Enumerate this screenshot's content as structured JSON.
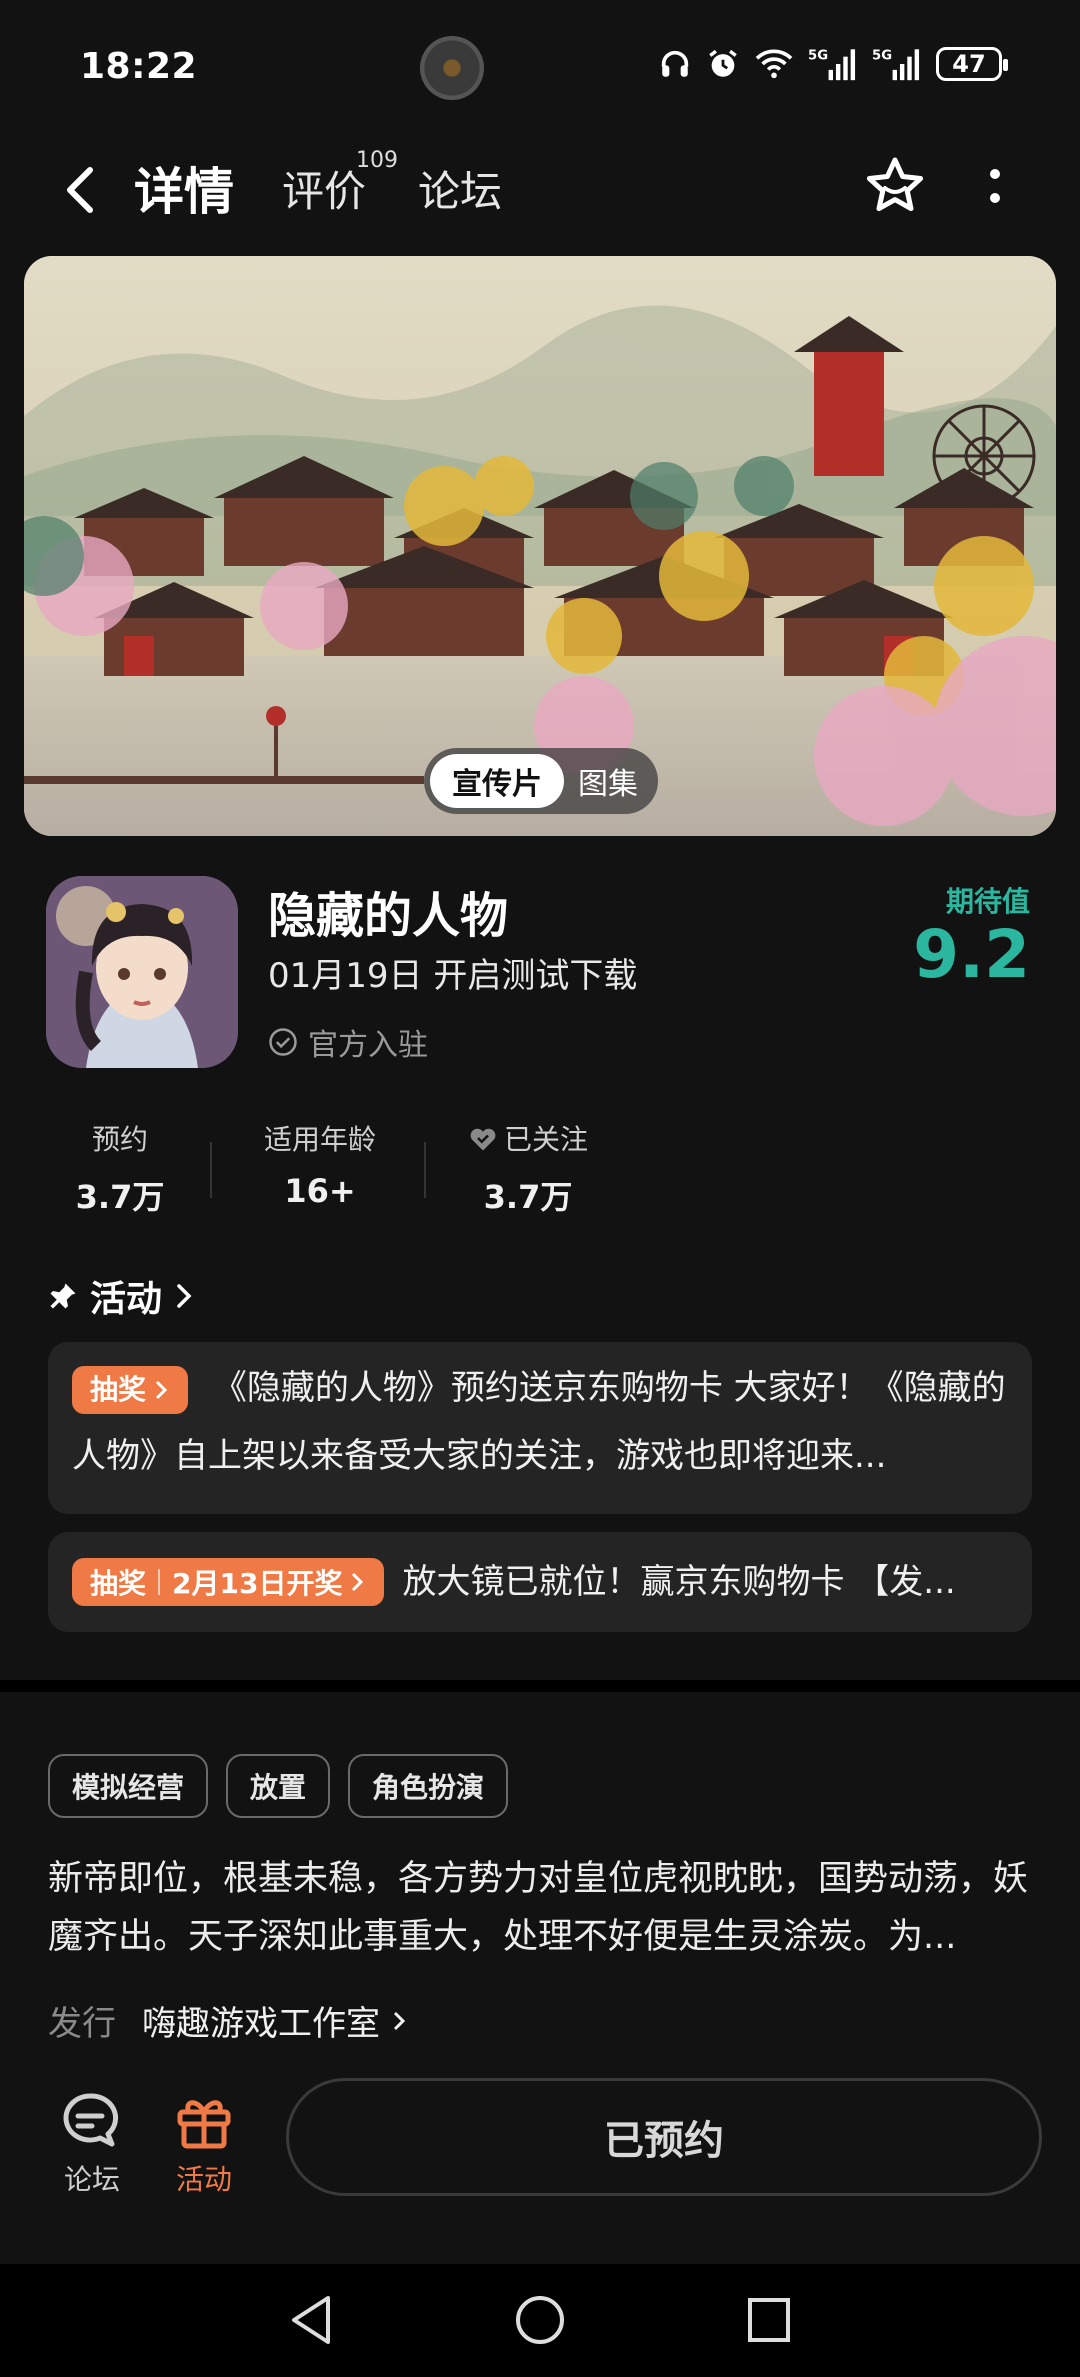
{
  "status_bar": {
    "time": "18:22",
    "battery": "47"
  },
  "nav": {
    "tabs": [
      {
        "label": "详情",
        "active": true
      },
      {
        "label": "评价",
        "count": "109"
      },
      {
        "label": "论坛"
      }
    ]
  },
  "hero": {
    "switch": {
      "active": "宣传片",
      "inactive": "图集"
    }
  },
  "app": {
    "name": "隐藏的人物",
    "subtitle": "01月19日 开启测试下载",
    "official": "官方入驻",
    "expect_label": "期待值",
    "expect_value": "9.2"
  },
  "stats": [
    {
      "label": "预约",
      "value": "3.7万"
    },
    {
      "label": "适用年龄",
      "value": "16+"
    },
    {
      "label": "已关注",
      "value": "3.7万"
    }
  ],
  "activity": {
    "heading": "活动",
    "items": [
      {
        "badge": "抽奖",
        "text": "《隐藏的人物》预约送京东购物卡 大家好！《隐藏的人物》自上架以来备受大家的关注，游戏也即将迎来..."
      },
      {
        "badge": "抽奖",
        "badge_extra": "2月13日开奖",
        "text": "放大镜已就位！赢京东购物卡 【发..."
      }
    ]
  },
  "tags": [
    "模拟经营",
    "放置",
    "角色扮演"
  ],
  "description": "新帝即位，根基未稳，各方势力对皇位虎视眈眈，国势动荡，妖魔齐出。天子深知此事重大，处理不好便是生灵涂炭。为...",
  "publisher": {
    "label": "发行",
    "name": "嗨趣游戏工作室"
  },
  "bottom_bar": {
    "forum_label": "论坛",
    "activity_label": "活动",
    "action_label": "已预约"
  },
  "colors": {
    "accent": "#2bb6a0",
    "activity": "#f07a45",
    "background": "#121212"
  }
}
